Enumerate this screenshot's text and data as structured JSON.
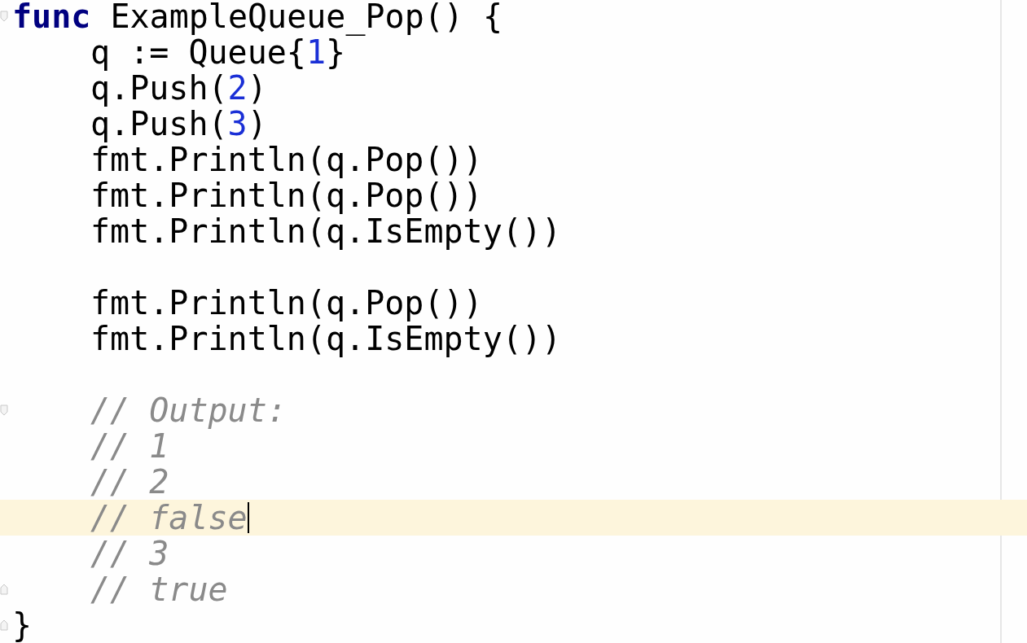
{
  "lines": [
    {
      "kind": "code",
      "fold_start": true,
      "tokens": [
        {
          "kind": "keyword",
          "text": "func"
        },
        {
          "kind": "plain",
          "text": " ExampleQueue_Pop() {"
        }
      ],
      "children": [
        {
          "kind": "code",
          "tokens": [
            {
              "kind": "plain",
              "text": "q := Queue{"
            },
            {
              "kind": "number",
              "text": "1"
            },
            {
              "kind": "plain",
              "text": "}"
            }
          ]
        },
        {
          "kind": "code",
          "tokens": [
            {
              "kind": "plain",
              "text": "q.Push("
            },
            {
              "kind": "number",
              "text": "2"
            },
            {
              "kind": "plain",
              "text": ")"
            }
          ]
        },
        {
          "kind": "code",
          "tokens": [
            {
              "kind": "plain",
              "text": "q.Push("
            },
            {
              "kind": "number",
              "text": "3"
            },
            {
              "kind": "plain",
              "text": ")"
            }
          ]
        },
        {
          "kind": "code",
          "tokens": [
            {
              "kind": "plain",
              "text": "fmt.Println(q.Pop())"
            }
          ]
        },
        {
          "kind": "code",
          "tokens": [
            {
              "kind": "plain",
              "text": "fmt.Println(q.Pop())"
            }
          ]
        },
        {
          "kind": "code",
          "tokens": [
            {
              "kind": "plain",
              "text": "fmt.Println(q.IsEmpty())"
            }
          ]
        },
        {
          "kind": "blank"
        },
        {
          "kind": "code",
          "tokens": [
            {
              "kind": "plain",
              "text": "fmt.Println(q.Pop())"
            }
          ]
        },
        {
          "kind": "code",
          "tokens": [
            {
              "kind": "plain",
              "text": "fmt.Println(q.IsEmpty())"
            }
          ]
        },
        {
          "kind": "blank"
        },
        {
          "kind": "code",
          "fold_start": true,
          "tokens": [
            {
              "kind": "comment",
              "text": "// Output:"
            }
          ]
        },
        {
          "kind": "code",
          "tokens": [
            {
              "kind": "comment",
              "text": "// 1"
            }
          ]
        },
        {
          "kind": "code",
          "tokens": [
            {
              "kind": "comment",
              "text": "// 2"
            }
          ]
        },
        {
          "kind": "code",
          "current": true,
          "caret": true,
          "tokens": [
            {
              "kind": "comment",
              "text": "// false"
            }
          ]
        },
        {
          "kind": "code",
          "tokens": [
            {
              "kind": "comment",
              "text": "// 3"
            }
          ]
        },
        {
          "kind": "code",
          "fold_end": true,
          "tokens": [
            {
              "kind": "comment",
              "text": "// true"
            }
          ]
        }
      ]
    },
    {
      "kind": "code",
      "fold_end": true,
      "tokens": [
        {
          "kind": "plain",
          "text": "}"
        }
      ]
    }
  ]
}
